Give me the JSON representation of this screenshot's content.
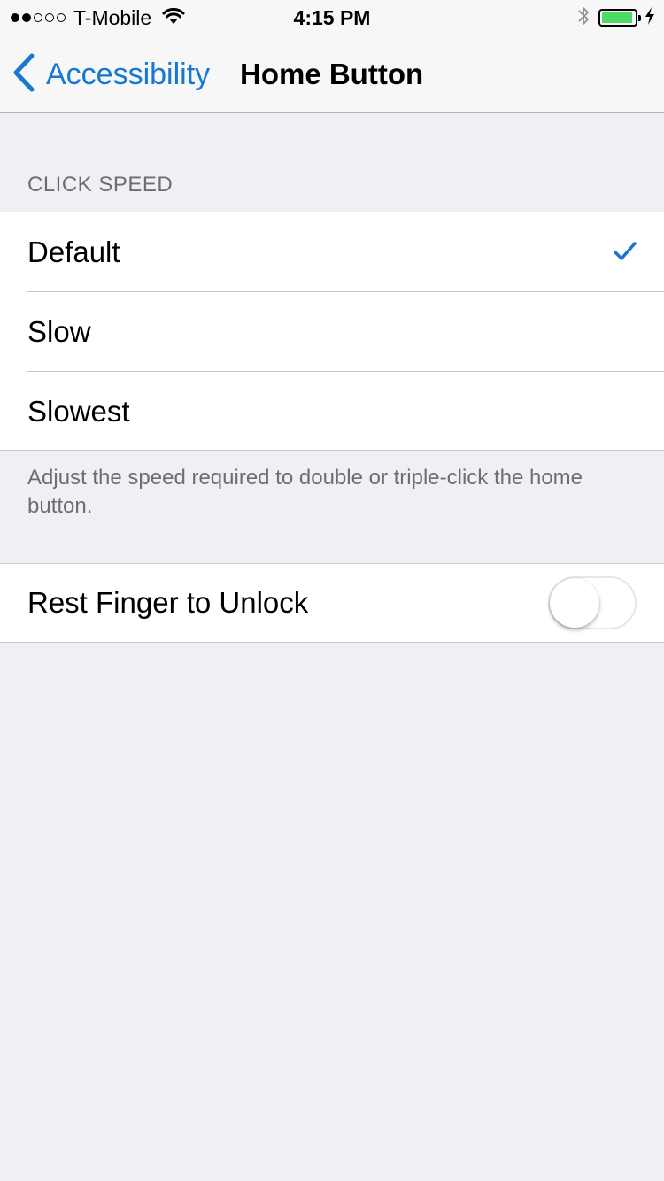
{
  "status_bar": {
    "carrier": "T-Mobile",
    "time": "4:15 PM",
    "signal_bars_filled": 2,
    "signal_bars_total": 5,
    "battery_level": 0.95,
    "icons": [
      "wifi-icon",
      "bluetooth-icon",
      "battery-icon",
      "charging-bolt-icon"
    ]
  },
  "nav": {
    "back_label": "Accessibility",
    "title": "Home Button"
  },
  "click_speed": {
    "header": "CLICK SPEED",
    "options": [
      {
        "label": "Default",
        "selected": true
      },
      {
        "label": "Slow",
        "selected": false
      },
      {
        "label": "Slowest",
        "selected": false
      }
    ],
    "footer": "Adjust the speed required to double or triple-click the home button."
  },
  "rest_finger": {
    "label": "Rest Finger to Unlock",
    "enabled": false
  },
  "colors": {
    "accent": "#1877d2",
    "background": "#efeff4",
    "battery": "#4cd964"
  }
}
